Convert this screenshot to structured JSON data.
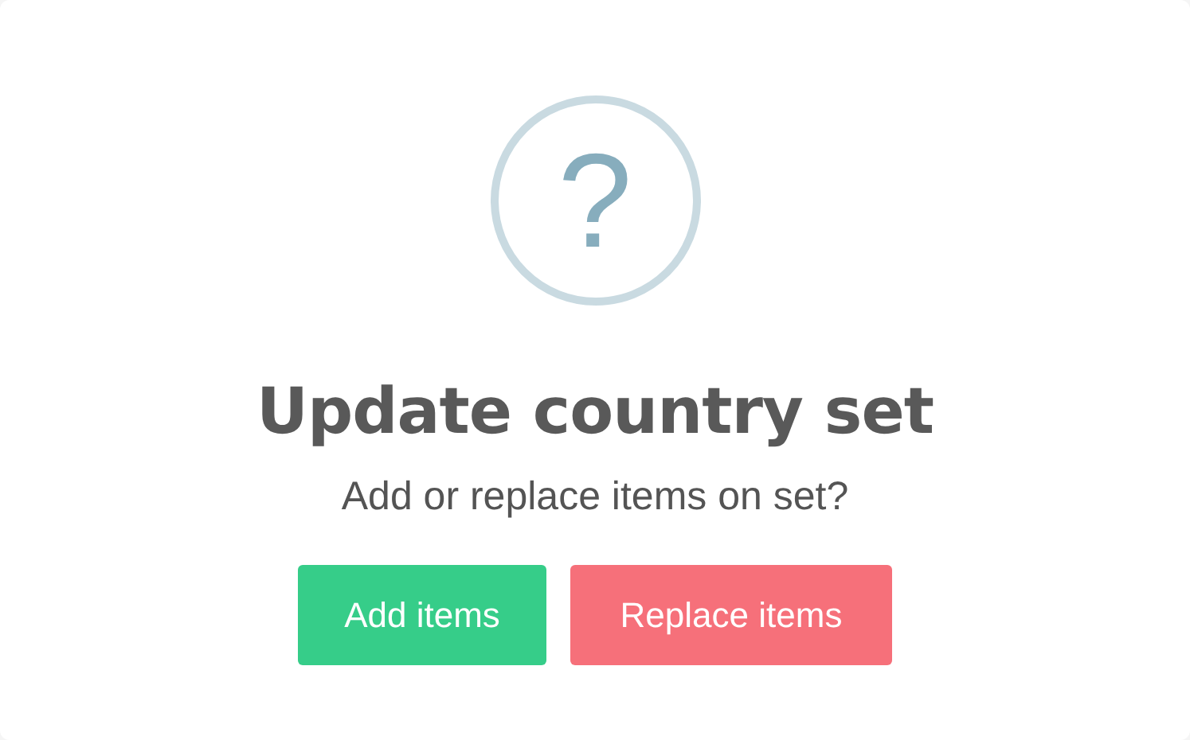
{
  "dialog": {
    "icon_glyph": "?",
    "title": "Update country set",
    "text": "Add or replace items on set?",
    "buttons": [
      {
        "label": "Add items",
        "kind": "confirm"
      },
      {
        "label": "Replace items",
        "kind": "deny"
      }
    ]
  }
}
